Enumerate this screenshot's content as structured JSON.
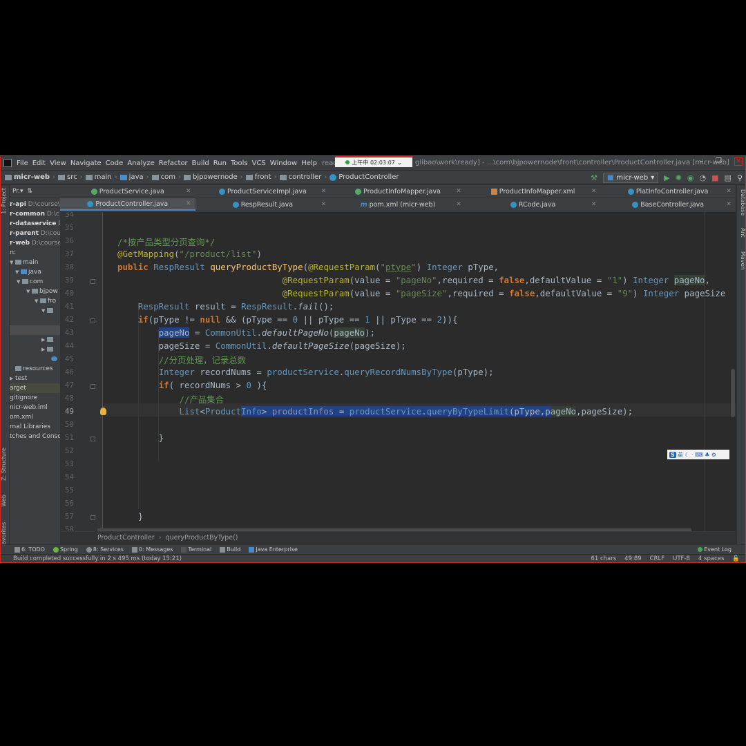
{
  "window": {
    "menu": [
      "File",
      "Edit",
      "View",
      "Navigate",
      "Code",
      "Analyze",
      "Refactor",
      "Build",
      "Run",
      "Tools",
      "VCS",
      "Window",
      "Help"
    ],
    "title_left": "ready [D:",
    "title_right": "glibao\\work\\ready] - ...\\com\\bjpowernode\\front\\controller\\ProductController.java [micr-web]",
    "clock": "上午中 02:03:07"
  },
  "navbar": {
    "crumbs": [
      "micr-web",
      "src",
      "main",
      "java",
      "com",
      "bjpowernode",
      "front",
      "controller",
      "ProductController"
    ],
    "run_config": "micr-web"
  },
  "project_panel": {
    "header": "Pr.▾",
    "rows": [
      {
        "name": "r-api",
        "path": "D:\\course\\"
      },
      {
        "name": "r-common",
        "path": "D:\\c"
      },
      {
        "name": "r-dataservice",
        "path": "D:"
      },
      {
        "name": "r-parent",
        "path": "D:\\cou"
      },
      {
        "name": "r-web",
        "path": "D:\\course"
      },
      {
        "name": "rc",
        "path": ""
      },
      {
        "name": "main",
        "path": ""
      },
      {
        "name": "java",
        "path": ""
      },
      {
        "name": "com",
        "path": ""
      },
      {
        "name": "bjpow",
        "path": ""
      },
      {
        "name": "fro",
        "path": ""
      },
      {
        "name": "",
        "path": ""
      },
      {
        "name": "",
        "path": ""
      },
      {
        "name": "",
        "path": ""
      },
      {
        "name": "",
        "path": ""
      },
      {
        "name": "",
        "path": ""
      },
      {
        "name": "",
        "path": ""
      },
      {
        "name": "resources",
        "path": ""
      },
      {
        "name": "test",
        "path": ""
      },
      {
        "name": "arget",
        "path": ""
      },
      {
        "name": "gitignore",
        "path": ""
      },
      {
        "name": "nicr-web.iml",
        "path": ""
      },
      {
        "name": "om.xml",
        "path": ""
      },
      {
        "name": "rnal Libraries",
        "path": ""
      },
      {
        "name": "tches and Conso",
        "path": ""
      }
    ]
  },
  "left_strip": [
    "1: Project",
    "Z: Structure",
    "Web",
    "2: Favorites"
  ],
  "right_strip": [
    "Database",
    "Ant",
    "Maven"
  ],
  "tabs": {
    "row1": [
      "ProductService.java",
      "ProductServiceImpl.java",
      "ProductInfoMapper.java",
      "ProductInfoMapper.xml",
      "PlatInfoController.java"
    ],
    "row2": [
      "ProductController.java",
      "RespResult.java",
      "pom.xml (micr-web)",
      "RCode.java",
      "BaseController.java"
    ],
    "active": "ProductController.java"
  },
  "editor": {
    "line_numbers": [
      "34",
      "35",
      "36",
      "37",
      "38",
      "39",
      "40",
      "41",
      "42",
      "43",
      "44",
      "45",
      "46",
      "47",
      "48",
      "49",
      "50",
      "51",
      "52",
      "53",
      "54",
      "55",
      "56",
      "57",
      "58"
    ],
    "current_line": "49"
  },
  "ime_bar": "英 ☾ · ⌨ ♣ ⚙",
  "breadcrumb": [
    "ProductController",
    "queryProductByType()"
  ],
  "tool_windows": [
    "6: TODO",
    "Spring",
    "8: Services",
    "0: Messages",
    "Terminal",
    "Build",
    "Java Enterprise"
  ],
  "event_log": "Event Log",
  "status": {
    "message": "Build completed successfully in 2 s 495 ms (today 15:21)",
    "chars": "61 chars",
    "position": "49:89",
    "line_sep": "CRLF",
    "encoding": "UTF-8",
    "indent": "4 spaces"
  }
}
